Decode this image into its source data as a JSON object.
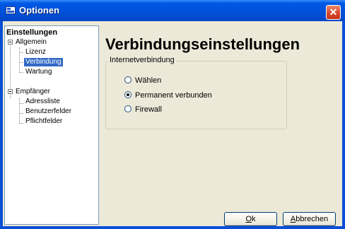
{
  "window": {
    "title": "Optionen",
    "icon": "options-window-icon",
    "close_label": "✕"
  },
  "tree": {
    "root": "Einstellungen",
    "groups": [
      {
        "label": "Allgemein",
        "expanded": true,
        "items": [
          "Lizenz",
          "Verbindung",
          "Wartung"
        ]
      },
      {
        "label": "Empfänger",
        "expanded": true,
        "items": [
          "Adressliste",
          "Benutzerfelder",
          "Pflichtfelder"
        ]
      }
    ],
    "selected": "Verbindung"
  },
  "main": {
    "title": "Verbindungseinstellungen",
    "group_label": "Internetverbindung",
    "options": [
      {
        "label": "Wählen",
        "checked": false
      },
      {
        "label": "Permanent verbunden",
        "checked": true
      },
      {
        "label": "Firewall",
        "checked": false
      }
    ]
  },
  "buttons": {
    "ok": {
      "mnemonic": "O",
      "rest": "k"
    },
    "cancel": {
      "mnemonic": "A",
      "rest": "bbrechen"
    }
  },
  "colors": {
    "titlebar": "#0058e6",
    "selection": "#316ac5",
    "close": "#d6452a",
    "background": "#ece9d8"
  }
}
